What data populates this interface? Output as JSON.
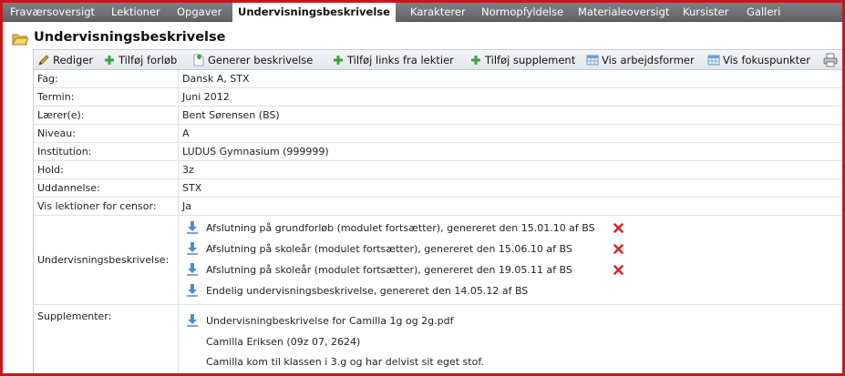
{
  "tabs": [
    {
      "label": "Fraværsoversigt",
      "active": false
    },
    {
      "label": "Lektioner",
      "active": false
    },
    {
      "label": "Opgaver",
      "active": false
    },
    {
      "label": "Undervisningsbeskrivelse",
      "active": true
    },
    {
      "label": "Karakterer",
      "active": false
    },
    {
      "label": "Normopfyldelse",
      "active": false
    },
    {
      "label": "Materialeoversigt",
      "active": false
    },
    {
      "label": "Kursister",
      "active": false
    },
    {
      "label": "Galleri",
      "active": false
    }
  ],
  "page": {
    "title": "Undervisningsbeskrivelse"
  },
  "toolbar": [
    {
      "label": "Rediger",
      "icon": "pencil-icon"
    },
    {
      "label": "Tilføj forløb",
      "icon": "plus-icon"
    },
    {
      "label": "Generer beskrivelse",
      "icon": "generate-document-icon"
    },
    {
      "label": "Tilføj links fra lektier",
      "icon": "plus-icon"
    },
    {
      "label": "Tilføj supplement",
      "icon": "plus-icon"
    },
    {
      "label": "Vis arbejdsformer",
      "icon": "table-icon"
    },
    {
      "label": "Vis fokuspunkter",
      "icon": "table-icon"
    },
    {
      "label": "",
      "icon": "printer-icon"
    }
  ],
  "fields": [
    {
      "label": "Fag:",
      "value": "Dansk A, STX"
    },
    {
      "label": "Termin:",
      "value": "Juni 2012"
    },
    {
      "label": "Lærer(e):",
      "value": "Bent Sørensen (BS)"
    },
    {
      "label": "Niveau:",
      "value": "A"
    },
    {
      "label": "Institution:",
      "value": "LUDUS Gymnasium (999999)"
    },
    {
      "label": "Hold:",
      "value": "3z"
    },
    {
      "label": "Uddannelse:",
      "value": "STX"
    },
    {
      "label": "Vis lektioner for censor:",
      "value": "Ja"
    }
  ],
  "descriptions": {
    "label": "Undervisningsbeskrivelse:",
    "items": [
      {
        "text": "Afslutning på grundforløb (modulet fortsætter), genereret den 15.01.10 af BS",
        "deletable": true
      },
      {
        "text": "Afslutning på skoleår (modulet fortsætter), genereret den 15.06.10 af BS",
        "deletable": true
      },
      {
        "text": "Afslutning på skoleår (modulet fortsætter), genereret den 19.05.11 af BS",
        "deletable": true
      },
      {
        "text": "Endelig undervisningsbeskrivelse, genereret den 14.05.12 af BS",
        "deletable": false
      }
    ]
  },
  "supplements": {
    "label": "Supplementer:",
    "file": "Undervisningbeskrivelse for Camilla 1g og 2g.pdf",
    "lines": [
      "Camilla Eriksen (09z 07, 2624)",
      "Camilla kom til klassen i 3.g og har delvist sit eget stof."
    ]
  },
  "colors": {
    "frame": "#c8161d",
    "tabbar": "#707176",
    "delete": "#d8262b",
    "plus": "#3aa33a"
  }
}
